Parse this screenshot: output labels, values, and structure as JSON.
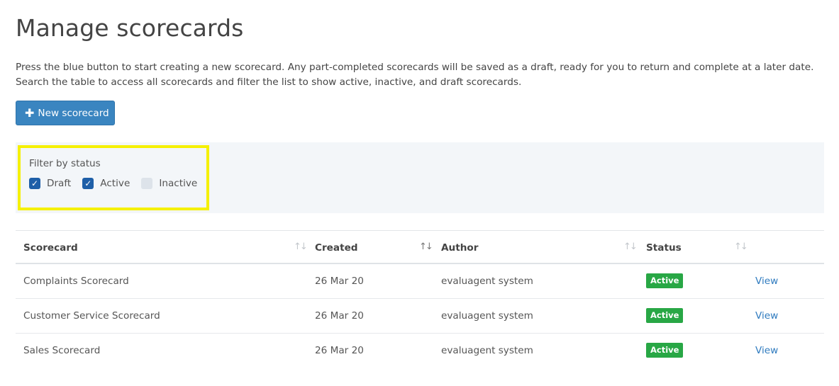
{
  "page": {
    "title": "Manage scorecards",
    "intro": "Press the blue button to start creating a new scorecard. Any part-completed scorecards will be saved as a draft, ready for you to return and complete at a later date. Search the table to access all scorecards and filter the list to show active, inactive, and draft scorecards."
  },
  "actions": {
    "new_icon": "plus-icon",
    "new_label": "New scorecard"
  },
  "filter": {
    "label": "Filter by status",
    "options": [
      {
        "label": "Draft",
        "checked": true
      },
      {
        "label": "Active",
        "checked": true
      },
      {
        "label": "Inactive",
        "checked": false
      }
    ],
    "highlight_color": "#f5f000"
  },
  "table": {
    "columns": [
      "Scorecard",
      "Created",
      "Author",
      "Status"
    ],
    "sort_icon": "sort-arrows-icon",
    "rows": [
      {
        "scorecard": "Complaints Scorecard",
        "created": "26 Mar 20",
        "author": "evaluagent system",
        "status": "Active",
        "action": "View"
      },
      {
        "scorecard": "Customer Service Scorecard",
        "created": "26 Mar 20",
        "author": "evaluagent system",
        "status": "Active",
        "action": "View"
      },
      {
        "scorecard": "Sales Scorecard",
        "created": "26 Mar 20",
        "author": "evaluagent system",
        "status": "Active",
        "action": "View"
      }
    ]
  },
  "colors": {
    "primary_button": "#3a85c0",
    "checkbox_checked": "#1e5fa8",
    "status_active": "#28a745",
    "link": "#2f7bbf",
    "filter_panel_bg": "#f3f6f9"
  }
}
